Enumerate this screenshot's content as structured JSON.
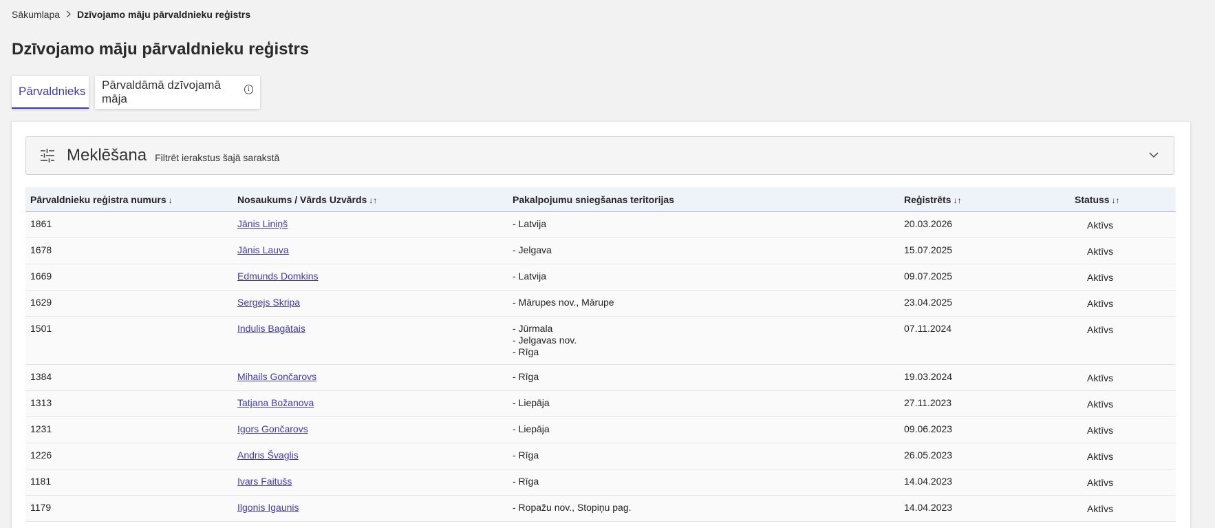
{
  "breadcrumb": {
    "home": "Sākumlapa",
    "current": "Dzīvojamo māju pārvaldnieku reģistrs"
  },
  "page_title": "Dzīvojamo māju pārvaldnieku reģistrs",
  "tabs": [
    {
      "label": "Pārvaldnieks",
      "active": true
    },
    {
      "label": "Pārvaldāmā dzīvojamā māja",
      "active": false,
      "icon": "info-icon"
    }
  ],
  "search": {
    "title": "Meklēšana",
    "subtitle": "Filtrēt ierakstus šajā sarakstā",
    "icon": "filter-sliders-icon"
  },
  "table": {
    "headers": {
      "number": "Pārvaldnieku reģistra numurs",
      "number_sort": "↓",
      "name": "Nosaukums / Vārds Uzvārds",
      "name_sort": "↓↑",
      "territory": "Pakalpojumu sniegšanas teritorijas",
      "registered": "Reģistrēts",
      "registered_sort": "↓↑",
      "status": "Statuss",
      "status_sort": "↓↑"
    },
    "rows": [
      {
        "number": "1861",
        "name": "Jānis Liniņš",
        "territory": [
          "- Latvija"
        ],
        "registered": "20.03.2026",
        "status": "Aktīvs"
      },
      {
        "number": "1678",
        "name": "Jānis Lauva",
        "territory": [
          "- Jelgava"
        ],
        "registered": "15.07.2025",
        "status": "Aktīvs"
      },
      {
        "number": "1669",
        "name": "Edmunds Domkins",
        "territory": [
          "- Latvija"
        ],
        "registered": "09.07.2025",
        "status": "Aktīvs"
      },
      {
        "number": "1629",
        "name": "Sergejs Skripa",
        "territory": [
          "- Mārupes nov., Mārupe"
        ],
        "registered": "23.04.2025",
        "status": "Aktīvs"
      },
      {
        "number": "1501",
        "name": "Indulis Bagātais",
        "territory": [
          "- Jūrmala",
          "- Jelgavas nov.",
          "- Rīga"
        ],
        "registered": "07.11.2024",
        "status": "Aktīvs"
      },
      {
        "number": "1384",
        "name": "Mihails Gončarovs",
        "territory": [
          "- Rīga"
        ],
        "registered": "19.03.2024",
        "status": "Aktīvs"
      },
      {
        "number": "1313",
        "name": "Tatjana Božanova",
        "territory": [
          "- Liepāja"
        ],
        "registered": "27.11.2023",
        "status": "Aktīvs"
      },
      {
        "number": "1231",
        "name": "Igors Gončarovs",
        "territory": [
          "- Liepāja"
        ],
        "registered": "09.06.2023",
        "status": "Aktīvs"
      },
      {
        "number": "1226",
        "name": "Andris Švaglis",
        "territory": [
          "- Rīga"
        ],
        "registered": "26.05.2023",
        "status": "Aktīvs"
      },
      {
        "number": "1181",
        "name": "Ivars Faitušs",
        "territory": [
          "- Rīga"
        ],
        "registered": "14.04.2023",
        "status": "Aktīvs"
      },
      {
        "number": "1179",
        "name": "Ilgonis Igaunis",
        "territory": [
          "- Ropažu nov., Stopiņu pag."
        ],
        "registered": "14.04.2023",
        "status": "Aktīvs"
      }
    ]
  },
  "colors": {
    "accent": "#3b3bbf",
    "header_bg": "#eef2f9",
    "page_bg": "#f2f2f2"
  }
}
